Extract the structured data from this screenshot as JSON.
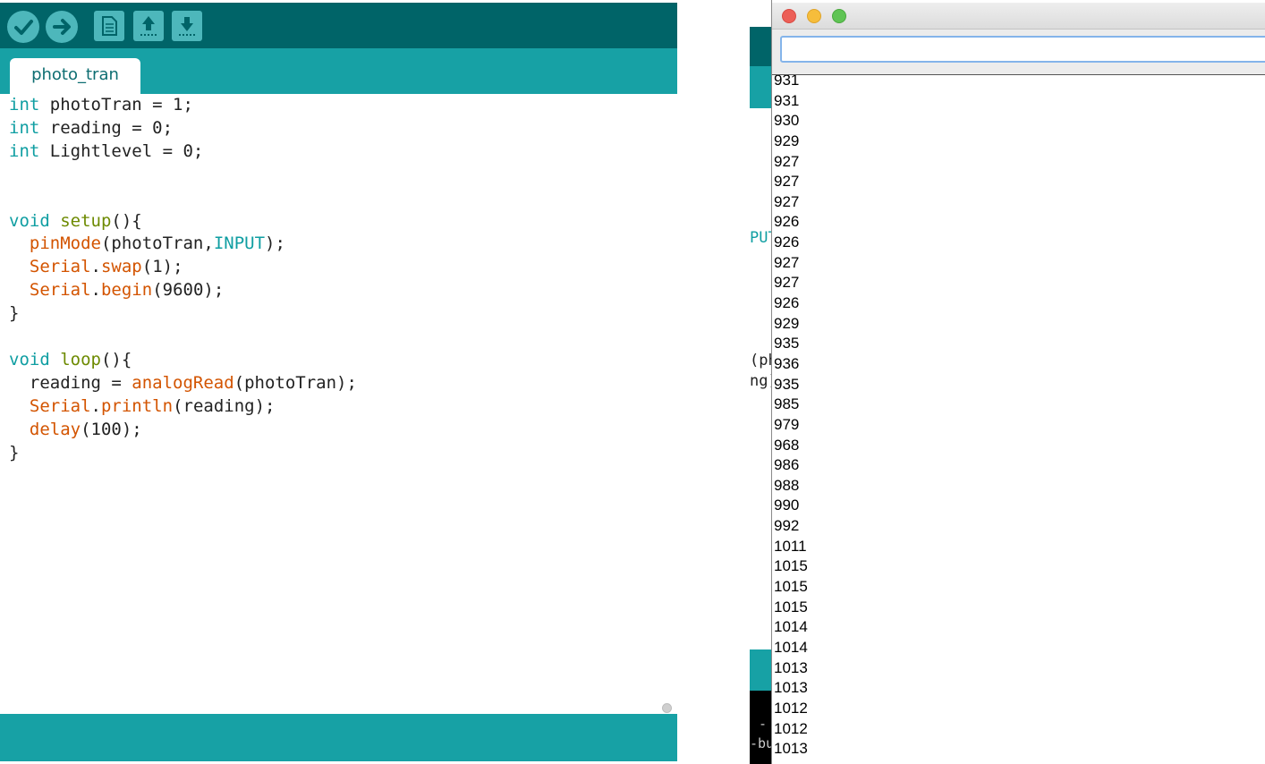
{
  "ide": {
    "toolbar": {
      "verify_icon": "checkmark-icon",
      "upload_icon": "arrow-right-icon",
      "new_icon": "new-file-icon",
      "open_icon": "open-upload-icon",
      "save_icon": "save-download-icon"
    },
    "tab_label": "photo_tran",
    "code": {
      "line1": {
        "kw": "int",
        "rest": " photoTran = 1;"
      },
      "line2": {
        "kw": "int",
        "rest": " reading = 0;"
      },
      "line3": {
        "kw": "int",
        "rest": " Lightlevel = 0;"
      },
      "setup_kw": "void",
      "setup_fn": "setup",
      "setup_rest": "(){",
      "pinmode_fn": "pinMode",
      "pinmode_args": "(photoTran,",
      "pinmode_const": "INPUT",
      "pinmode_end": ");",
      "swap_obj": "Serial",
      "swap_dot": ".",
      "swap_fn": "swap",
      "swap_rest": "(1);",
      "begin_obj": "Serial",
      "begin_dot": ".",
      "begin_fn": "begin",
      "begin_rest": "(9600);",
      "close1": "}",
      "loop_kw": "void",
      "loop_fn": "loop",
      "loop_rest": "(){",
      "read_pre": "reading = ",
      "read_fn": "analogRead",
      "read_rest": "(photoTran);",
      "println_obj": "Serial",
      "println_dot": ".",
      "println_fn": "println",
      "println_rest": "(reading);",
      "delay_fn": "delay",
      "delay_rest": "(100);",
      "close2": "}"
    },
    "colors": {
      "toolbar": "#006468",
      "tabstrip": "#17a1a5",
      "keyword": "#0f9ea2",
      "function": "#d35400"
    }
  },
  "behind": {
    "fragment1": "PUT",
    "fragment2": "(ph",
    "fragment3": "ng)",
    "fragment4": "-",
    "fragment5": "-bu"
  },
  "serial_monitor": {
    "input_value": "",
    "output_lines": [
      "931",
      "931",
      "930",
      "929",
      "927",
      "927",
      "927",
      "926",
      "926",
      "927",
      "927",
      "926",
      "929",
      "935",
      "936",
      "935",
      "985",
      "979",
      "968",
      "986",
      "988",
      "990",
      "992",
      "1011",
      "1015",
      "1015",
      "1015",
      "1014",
      "1014",
      "1013",
      "1013",
      "1012",
      "1012",
      "1013"
    ]
  }
}
